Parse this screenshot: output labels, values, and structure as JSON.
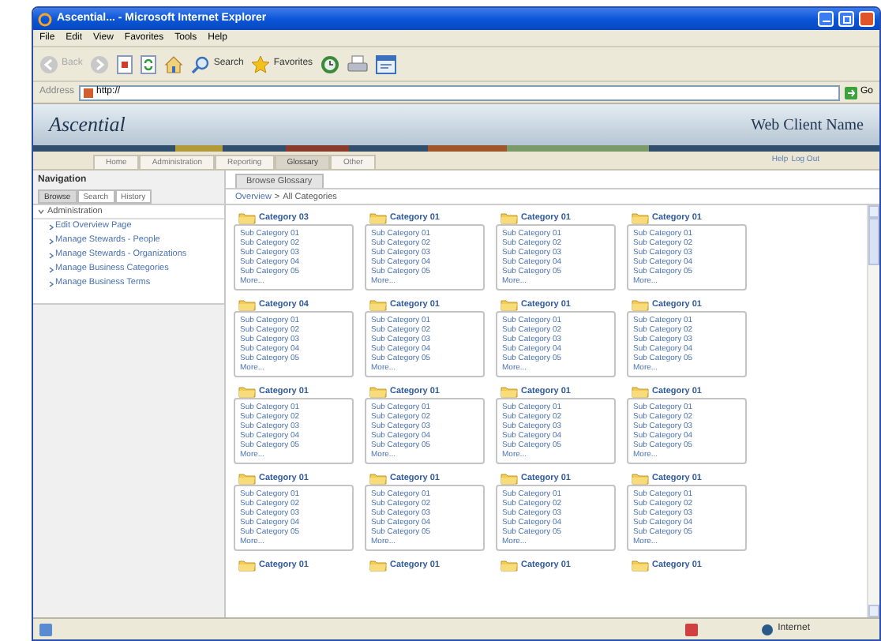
{
  "window": {
    "title": "Ascential... - Microsoft Internet Explorer"
  },
  "menu": [
    "File",
    "Edit",
    "View",
    "Favorites",
    "Tools",
    "Help"
  ],
  "toolbar": [
    {
      "kind": "back",
      "label": "Back"
    },
    {
      "kind": "forward"
    },
    {
      "kind": "stop"
    },
    {
      "kind": "refresh"
    },
    {
      "kind": "home"
    },
    {
      "kind": "search",
      "label": "Search"
    },
    {
      "kind": "favorites",
      "label": "Favorites"
    },
    {
      "kind": "history"
    },
    {
      "kind": "print"
    },
    {
      "kind": "edit"
    }
  ],
  "address": {
    "label": "Address",
    "value": "http://",
    "go": "Go"
  },
  "banner": {
    "logo": "Ascential",
    "client": "Web Client Name"
  },
  "tabs": [
    {
      "label": "Home",
      "selected": false
    },
    {
      "label": "Administration",
      "selected": false
    },
    {
      "label": "Reporting",
      "selected": false
    },
    {
      "label": "Glossary",
      "selected": true
    },
    {
      "label": "Other",
      "selected": false
    }
  ],
  "top_links": [
    "Help",
    "Log Out"
  ],
  "navigation": {
    "title": "Navigation",
    "tabs": [
      {
        "label": "Browse",
        "selected": true
      },
      {
        "label": "Search",
        "selected": false
      },
      {
        "label": "History",
        "selected": false
      }
    ],
    "section": {
      "label": "Administration",
      "expanded": true,
      "children": [
        "Edit Overview Page",
        "Manage Stewards - People",
        "Manage Stewards - Organizations",
        "Manage Business Categories",
        "Manage Business Terms"
      ]
    }
  },
  "main": {
    "tab": "Browse Glossary",
    "breadcrumb": [
      {
        "label": "Overview"
      },
      {
        "label": "All Categories"
      }
    ],
    "separator": ">",
    "cards": [
      {
        "title": "Category 03",
        "items": [
          "Sub Category 01",
          "Sub Category 02",
          "Sub Category 03",
          "Sub Category 04",
          "Sub Category 05"
        ],
        "more": "More..."
      },
      {
        "title": "Category 01",
        "items": [
          "Sub Category 01",
          "Sub Category 02",
          "Sub Category 03",
          "Sub Category 04",
          "Sub Category 05"
        ],
        "more": "More..."
      },
      {
        "title": "Category 01",
        "items": [
          "Sub Category 01",
          "Sub Category 02",
          "Sub Category 03",
          "Sub Category 04",
          "Sub Category 05"
        ],
        "more": "More..."
      },
      {
        "title": "Category 01",
        "items": [
          "Sub Category 01",
          "Sub Category 02",
          "Sub Category 03",
          "Sub Category 04",
          "Sub Category 05"
        ],
        "more": "More..."
      },
      {
        "title": "Category 04",
        "items": [
          "Sub Category 01",
          "Sub Category 02",
          "Sub Category 03",
          "Sub Category 04",
          "Sub Category 05"
        ],
        "more": "More..."
      },
      {
        "title": "Category 01",
        "items": [
          "Sub Category 01",
          "Sub Category 02",
          "Sub Category 03",
          "Sub Category 04",
          "Sub Category 05"
        ],
        "more": "More..."
      },
      {
        "title": "Category 01",
        "items": [
          "Sub Category 01",
          "Sub Category 02",
          "Sub Category 03",
          "Sub Category 04",
          "Sub Category 05"
        ],
        "more": "More..."
      },
      {
        "title": "Category 01",
        "items": [
          "Sub Category 01",
          "Sub Category 02",
          "Sub Category 03",
          "Sub Category 04",
          "Sub Category 05"
        ],
        "more": "More..."
      },
      {
        "title": "Category 01",
        "items": [
          "Sub Category 01",
          "Sub Category 02",
          "Sub Category 03",
          "Sub Category 04",
          "Sub Category 05"
        ],
        "more": "More..."
      },
      {
        "title": "Category 01",
        "items": [
          "Sub Category 01",
          "Sub Category 02",
          "Sub Category 03",
          "Sub Category 04",
          "Sub Category 05"
        ],
        "more": "More..."
      },
      {
        "title": "Category 01",
        "items": [
          "Sub Category 01",
          "Sub Category 02",
          "Sub Category 03",
          "Sub Category 04",
          "Sub Category 05"
        ],
        "more": "More..."
      },
      {
        "title": "Category 01",
        "items": [
          "Sub Category 01",
          "Sub Category 02",
          "Sub Category 03",
          "Sub Category 04",
          "Sub Category 05"
        ],
        "more": "More..."
      },
      {
        "title": "Category 01",
        "items": [
          "Sub Category 01",
          "Sub Category 02",
          "Sub Category 03",
          "Sub Category 04",
          "Sub Category 05"
        ],
        "more": "More..."
      },
      {
        "title": "Category 01",
        "items": [
          "Sub Category 01",
          "Sub Category 02",
          "Sub Category 03",
          "Sub Category 04",
          "Sub Category 05"
        ],
        "more": "More..."
      },
      {
        "title": "Category 01",
        "items": [
          "Sub Category 01",
          "Sub Category 02",
          "Sub Category 03",
          "Sub Category 04",
          "Sub Category 05"
        ],
        "more": "More..."
      },
      {
        "title": "Category 01",
        "items": [
          "Sub Category 01",
          "Sub Category 02",
          "Sub Category 03",
          "Sub Category 04",
          "Sub Category 05"
        ],
        "more": "More..."
      },
      {
        "title": "Category 01"
      },
      {
        "title": "Category 01"
      },
      {
        "title": "Category 01"
      },
      {
        "title": "Category 01"
      }
    ]
  },
  "status_bar": {
    "zone": "Internet"
  }
}
